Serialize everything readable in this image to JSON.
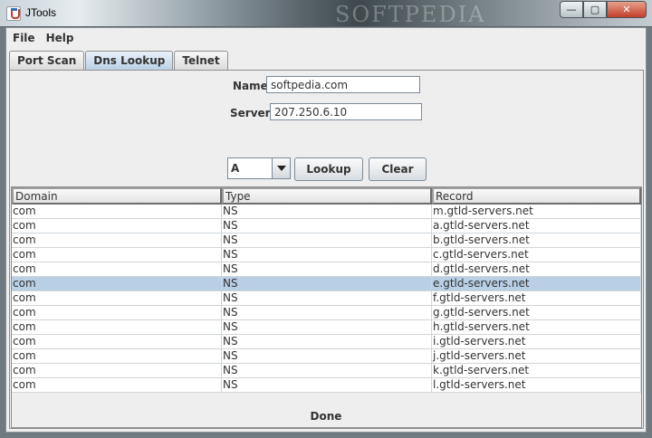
{
  "window": {
    "title": "JTools",
    "watermark": "SOFTPEDIA",
    "controls": {
      "minimize": "—",
      "maximize": "▢",
      "close": "✕"
    }
  },
  "menu": [
    "File",
    "Help"
  ],
  "tabs": [
    {
      "label": "Port Scan",
      "active": false
    },
    {
      "label": "Dns Lookup",
      "active": true
    },
    {
      "label": "Telnet",
      "active": false
    }
  ],
  "form": {
    "name_label": "Name",
    "name_value": "softpedia.com",
    "server_label": "Server",
    "server_value": "207.250.6.10",
    "record_type": "A",
    "lookup_label": "Lookup",
    "clear_label": "Clear"
  },
  "table": {
    "columns": [
      "Domain",
      "Type",
      "Record"
    ],
    "selected_row": 5,
    "rows": [
      [
        "com",
        "NS",
        "m.gtld-servers.net"
      ],
      [
        "com",
        "NS",
        "a.gtld-servers.net"
      ],
      [
        "com",
        "NS",
        "b.gtld-servers.net"
      ],
      [
        "com",
        "NS",
        "c.gtld-servers.net"
      ],
      [
        "com",
        "NS",
        "d.gtld-servers.net"
      ],
      [
        "com",
        "NS",
        "e.gtld-servers.net"
      ],
      [
        "com",
        "NS",
        "f.gtld-servers.net"
      ],
      [
        "com",
        "NS",
        "g.gtld-servers.net"
      ],
      [
        "com",
        "NS",
        "h.gtld-servers.net"
      ],
      [
        "com",
        "NS",
        "i.gtld-servers.net"
      ],
      [
        "com",
        "NS",
        "j.gtld-servers.net"
      ],
      [
        "com",
        "NS",
        "k.gtld-servers.net"
      ],
      [
        "com",
        "NS",
        "l.gtld-servers.net"
      ]
    ]
  },
  "status": "Done",
  "colors": {
    "selection": "#b8cfe5",
    "active_tab": "#b8cfe5"
  }
}
